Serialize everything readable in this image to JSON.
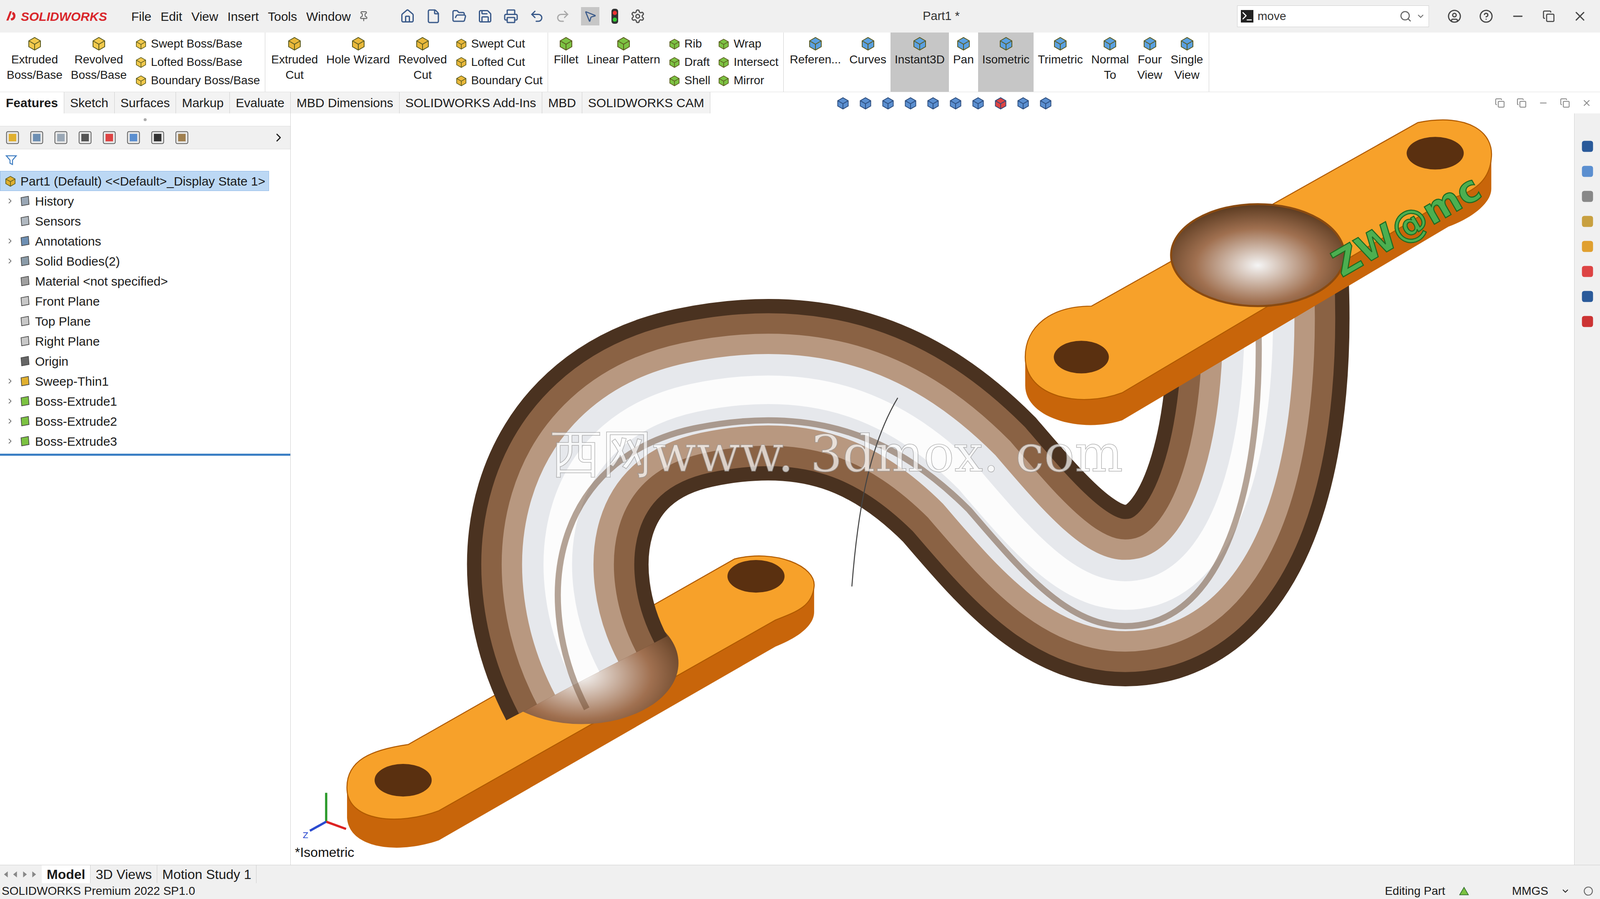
{
  "app": {
    "logo": "SOLIDWORKS",
    "document_title": "Part1 *",
    "search": {
      "value": "move"
    }
  },
  "menu": [
    "File",
    "Edit",
    "View",
    "Insert",
    "Tools",
    "Window"
  ],
  "ribbon": [
    {
      "items": [
        {
          "kind": "large",
          "label": [
            "Extruded",
            "Boss/Base"
          ],
          "selected": false
        },
        {
          "kind": "large",
          "label": [
            "Revolved",
            "Boss/Base"
          ],
          "selected": false
        },
        {
          "kind": "column",
          "entries": [
            "Swept Boss/Base",
            "Lofted Boss/Base",
            "Boundary Boss/Base"
          ]
        }
      ]
    },
    {
      "items": [
        {
          "kind": "large",
          "label": [
            "Extruded",
            "Cut"
          ],
          "selected": false
        },
        {
          "kind": "large",
          "label": [
            "Hole Wizard"
          ],
          "selected": false
        },
        {
          "kind": "large",
          "label": [
            "Revolved",
            "Cut"
          ],
          "selected": false
        },
        {
          "kind": "column",
          "entries": [
            "Swept Cut",
            "Lofted Cut",
            "Boundary Cut"
          ]
        }
      ]
    },
    {
      "items": [
        {
          "kind": "large",
          "label": [
            "Fillet"
          ],
          "selected": false
        },
        {
          "kind": "large",
          "label": [
            "Linear Pattern"
          ],
          "selected": false
        },
        {
          "kind": "column",
          "entries": [
            "Rib",
            "Draft",
            "Shell"
          ]
        },
        {
          "kind": "column",
          "entries": [
            "Wrap",
            "Intersect",
            "Mirror"
          ]
        }
      ]
    },
    {
      "items": [
        {
          "kind": "large",
          "label": [
            "Referen..."
          ],
          "selected": false
        },
        {
          "kind": "large",
          "label": [
            "Curves"
          ],
          "selected": false
        },
        {
          "kind": "large",
          "label": [
            "Instant3D"
          ],
          "selected": true
        },
        {
          "kind": "large",
          "label": [
            "Pan"
          ],
          "selected": false
        },
        {
          "kind": "large",
          "label": [
            "Isometric"
          ],
          "selected": true
        },
        {
          "kind": "large",
          "label": [
            "Trimetric"
          ],
          "selected": false
        },
        {
          "kind": "large",
          "label": [
            "Normal",
            "To"
          ],
          "selected": false
        },
        {
          "kind": "large",
          "label": [
            "Four",
            "View"
          ],
          "selected": false
        },
        {
          "kind": "large",
          "label": [
            "Single",
            "View"
          ],
          "selected": false
        }
      ]
    }
  ],
  "tabs": [
    {
      "label": "Features",
      "selected": true
    },
    {
      "label": "Sketch",
      "selected": false
    },
    {
      "label": "Surfaces",
      "selected": false
    },
    {
      "label": "Markup",
      "selected": false
    },
    {
      "label": "Evaluate",
      "selected": false
    },
    {
      "label": "MBD Dimensions",
      "selected": false
    },
    {
      "label": "SOLIDWORKS Add-Ins",
      "selected": false
    },
    {
      "label": "MBD",
      "selected": false
    },
    {
      "label": "SOLIDWORKS CAM",
      "selected": false
    }
  ],
  "tree": {
    "root": {
      "label": "Part1 (Default) <<Default>_Display State 1>",
      "selected": true
    },
    "items": [
      {
        "label": "History",
        "expandable": true
      },
      {
        "label": "Sensors",
        "expandable": false
      },
      {
        "label": "Annotations",
        "expandable": true
      },
      {
        "label": "Solid Bodies(2)",
        "expandable": true
      },
      {
        "label": "Material <not specified>",
        "expandable": false
      },
      {
        "label": "Front Plane",
        "expandable": false
      },
      {
        "label": "Top Plane",
        "expandable": false
      },
      {
        "label": "Right Plane",
        "expandable": false
      },
      {
        "label": "Origin",
        "expandable": false
      },
      {
        "label": "Sweep-Thin1",
        "expandable": true
      },
      {
        "label": "Boss-Extrude1",
        "expandable": true
      },
      {
        "label": "Boss-Extrude2",
        "expandable": true
      },
      {
        "label": "Boss-Extrude3",
        "expandable": true
      }
    ]
  },
  "graphics": {
    "watermark": "西网www. 3dmox. com",
    "model_text": "ZW@mc",
    "view_label": "*Isometric",
    "triad_label": "Z"
  },
  "bottom_tabs": [
    {
      "label": "Model",
      "selected": true
    },
    {
      "label": "3D Views",
      "selected": false
    },
    {
      "label": "Motion Study 1",
      "selected": false
    }
  ],
  "status_bar": {
    "product": "SOLIDWORKS Premium 2022 SP1.0",
    "mode": "Editing Part",
    "units": "MMGS"
  }
}
